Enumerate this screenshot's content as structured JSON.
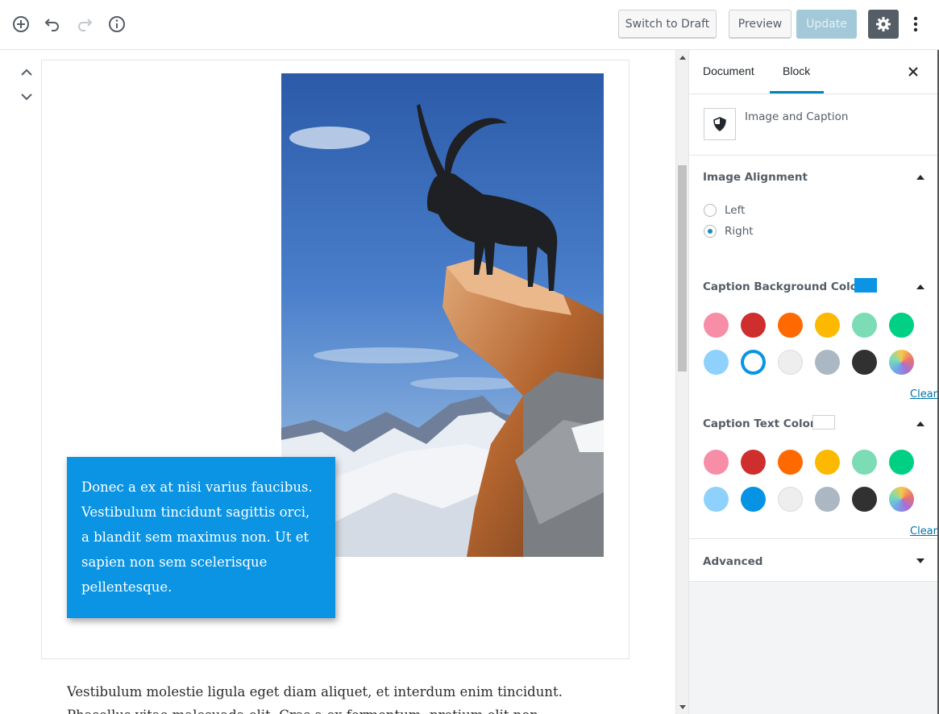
{
  "toolbar": {
    "add_icon": "plus-circle-icon",
    "undo_icon": "undo-icon",
    "redo_icon": "redo-icon",
    "info_icon": "info-icon",
    "switch_to_draft": "Switch to Draft",
    "preview": "Preview",
    "update": "Update",
    "settings_icon": "gear-icon",
    "more_icon": "vertical-ellipsis-icon"
  },
  "editor": {
    "caption_text": "Donec a ex at nisi varius faucibus. Vestibulum tincidunt sagittis orci, a blandit sem maximus non. Ut et sapien non sem scelerisque pellentesque.",
    "paragraph_line1": "Vestibulum molestie ligula eget diam aliquet, et interdum enim tincidunt.",
    "paragraph_line2": "Phasellus vitae malesuada elit. Cras a ex fermentum, pretium elit non",
    "caption_bg_color": "#0a94e3"
  },
  "sidebar": {
    "tabs": [
      {
        "label": "Document",
        "active": false
      },
      {
        "label": "Block",
        "active": true
      }
    ],
    "block_name": "Image and Caption",
    "block_icon": "shield-icon",
    "image_alignment": {
      "title": "Image Alignment",
      "options": [
        {
          "label": "Left",
          "checked": false
        },
        {
          "label": "Right",
          "checked": true
        }
      ]
    },
    "caption_bg": {
      "title": "Caption Background Color",
      "current": "#0a94e3",
      "clear": "Clear"
    },
    "caption_text": {
      "title": "Caption Text Color",
      "current": "#ffffff",
      "clear": "Clear"
    },
    "palette": [
      "#f78da7",
      "#cf2e2e",
      "#ff6900",
      "#fcb900",
      "#7bdcb5",
      "#00d084",
      "#8ed1fc",
      "#0693e3",
      "#eeeeee",
      "#abb8c3",
      "#313131",
      "gradient"
    ],
    "advanced": "Advanced"
  }
}
